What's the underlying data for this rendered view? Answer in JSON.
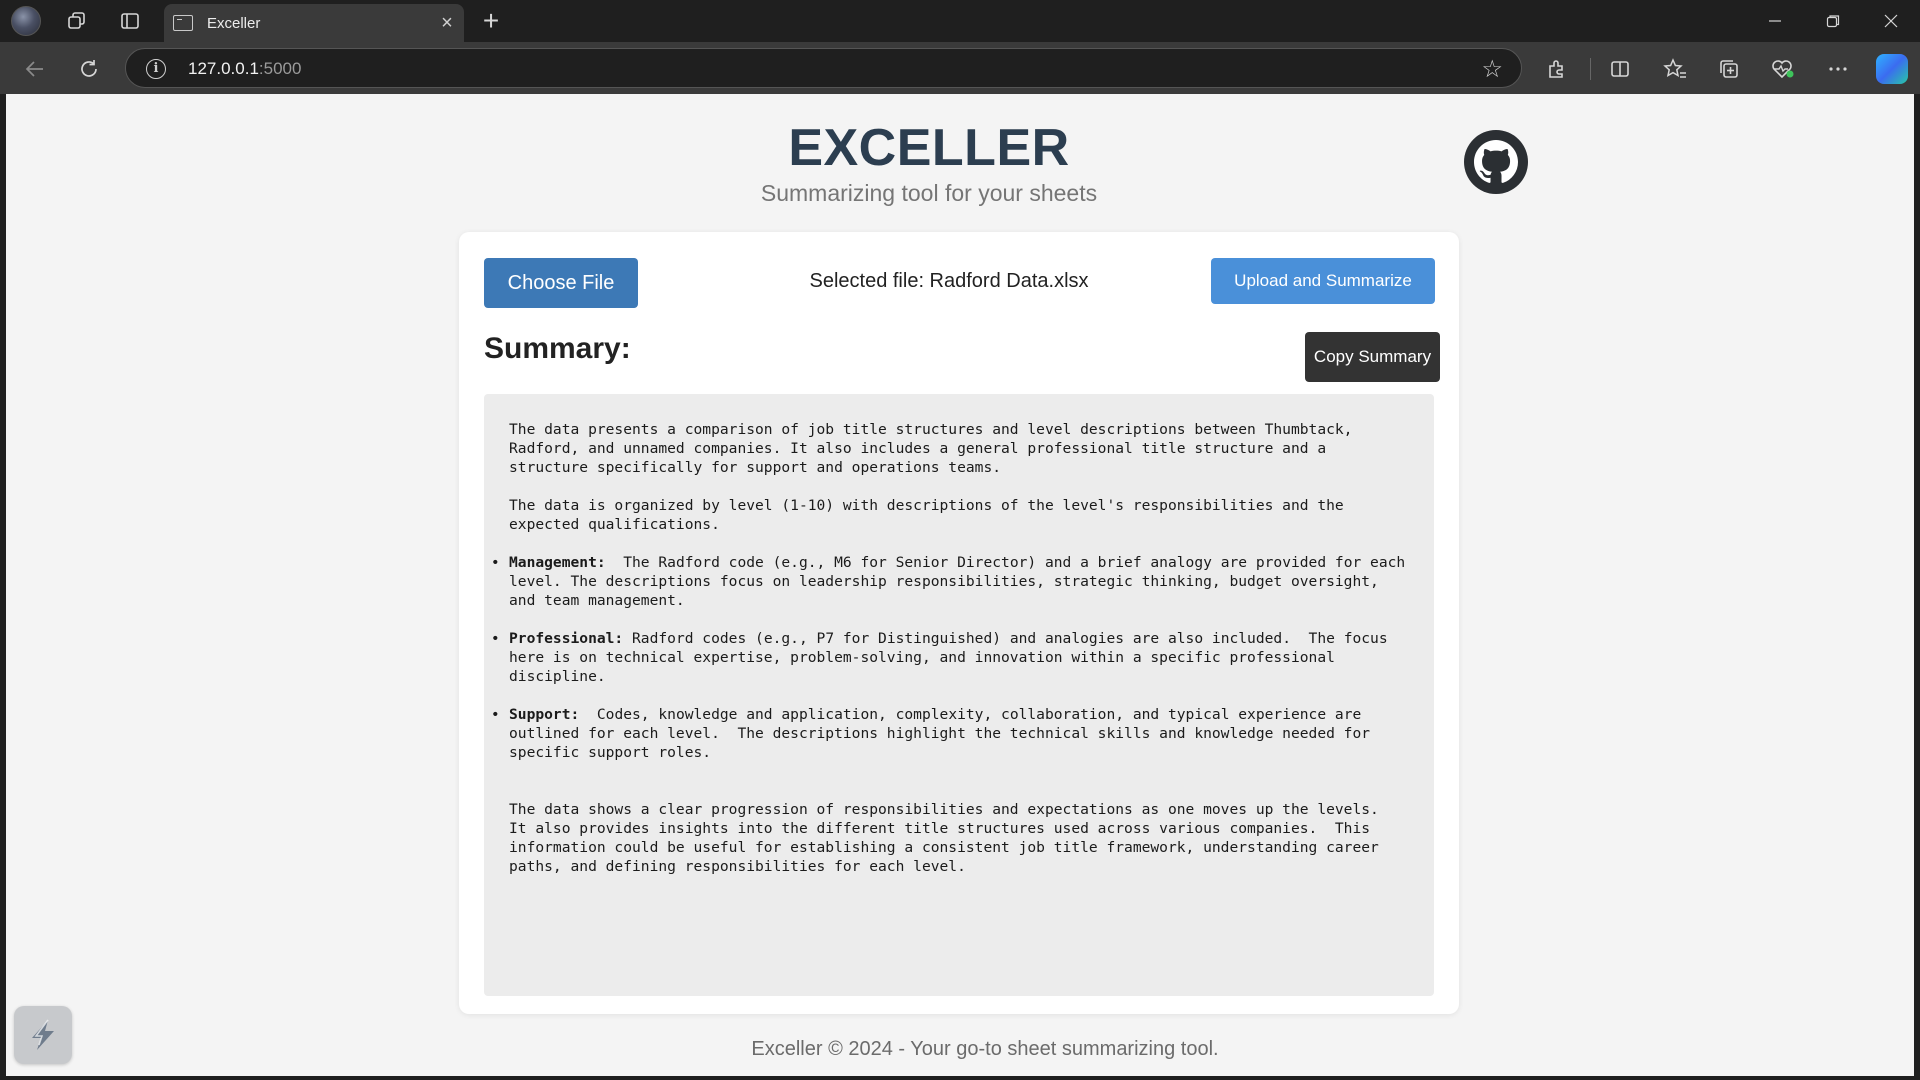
{
  "browser": {
    "tab_title": "Exceller",
    "new_tab_symbol": "+",
    "url_host": "127.0.0.1",
    "url_port": ":5000"
  },
  "page": {
    "title": "EXCELLER",
    "subtitle": "Summarizing tool for your sheets",
    "choose_file_label": "Choose File",
    "selected_file_text": "Selected file: Radford Data.xlsx",
    "upload_label": "Upload and Summarize",
    "summary_heading": "Summary:",
    "copy_label": "Copy Summary",
    "summary": {
      "intro_1": "The data presents a comparison of job title structures and level descriptions between Thumbtack, Radford, and unnamed companies. It also includes a general professional title structure and a structure specifically for support and operations teams.",
      "intro_2": "The data is organized by level (1-10) with descriptions of the level's responsibilities and the expected qualifications.",
      "bullets": [
        {
          "term": "Management:",
          "text": "  The Radford code (e.g., M6 for Senior Director) and a brief analogy are provided for each level. The descriptions focus on leadership responsibilities, strategic thinking, budget oversight, and team management."
        },
        {
          "term": "Professional:",
          "text": " Radford codes (e.g., P7 for Distinguished) and analogies are also included.  The focus here is on technical expertise, problem-solving, and innovation within a specific professional discipline."
        },
        {
          "term": "Support:",
          "text": "  Codes, knowledge and application, complexity, collaboration, and typical experience are outlined for each level.  The descriptions highlight the technical skills and knowledge needed for specific support roles."
        }
      ],
      "conclusion": "The data shows a clear progression of responsibilities and expectations as one moves up the levels.  It also provides insights into the different title structures used across various companies.  This information could be useful for establishing a consistent job title framework, understanding career paths, and defining responsibilities for each level."
    },
    "footer": "Exceller © 2024 - Your go-to sheet summarizing tool."
  },
  "colors": {
    "title": "#2c3e50",
    "choose_button": "#3d79b6",
    "upload_button": "#4a90d9",
    "copy_button": "#333333",
    "summary_background": "#ececec"
  },
  "icons": [
    "profile-avatar",
    "workspaces-icon",
    "tab-actions-icon",
    "window-favicon",
    "close-icon",
    "back-arrow-icon",
    "refresh-icon",
    "info-icon",
    "star-icon",
    "extensions-icon",
    "split-screen-icon",
    "favorites-icon",
    "collections-icon",
    "browser-essentials-icon",
    "more-icon",
    "copilot-icon",
    "github-icon",
    "lightning-tool-icon"
  ]
}
